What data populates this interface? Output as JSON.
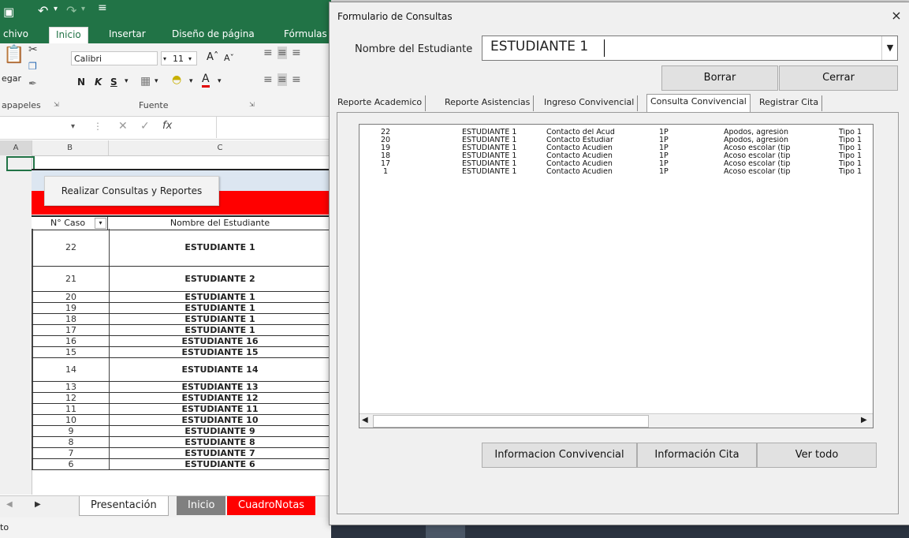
{
  "excel": {
    "tabs": [
      "chivo",
      "Inicio",
      "Insertar",
      "Diseño de página",
      "Fórmulas"
    ],
    "ribbon": {
      "paste_label": "egar",
      "font_name": "Calibri",
      "font_size": "11",
      "clipboard_group": "apapeles",
      "font_group": "Fuente",
      "bold": "N",
      "italic": "K",
      "underline": "S"
    },
    "formula_fx": "fx",
    "columns": [
      "A",
      "B",
      "C"
    ],
    "macro_button": "Realizar Consultas y Reportes",
    "table_headers": {
      "caso": "N° Caso",
      "nombre": "Nombre del Estudiante"
    },
    "rows": [
      {
        "caso": "22",
        "nombre": "ESTUDIANTE 1"
      },
      {
        "caso": "21",
        "nombre": "ESTUDIANTE 2"
      },
      {
        "caso": "20",
        "nombre": "ESTUDIANTE 1"
      },
      {
        "caso": "19",
        "nombre": "ESTUDIANTE 1"
      },
      {
        "caso": "18",
        "nombre": "ESTUDIANTE 1"
      },
      {
        "caso": "17",
        "nombre": "ESTUDIANTE 1"
      },
      {
        "caso": "16",
        "nombre": "ESTUDIANTE 16"
      },
      {
        "caso": "15",
        "nombre": "ESTUDIANTE 15"
      },
      {
        "caso": "14",
        "nombre": "ESTUDIANTE 14"
      },
      {
        "caso": "13",
        "nombre": "ESTUDIANTE 13"
      },
      {
        "caso": "12",
        "nombre": "ESTUDIANTE 12"
      },
      {
        "caso": "11",
        "nombre": "ESTUDIANTE 11"
      },
      {
        "caso": "10",
        "nombre": "ESTUDIANTE 10"
      },
      {
        "caso": "9",
        "nombre": "ESTUDIANTE 9"
      },
      {
        "caso": "8",
        "nombre": "ESTUDIANTE 8"
      },
      {
        "caso": "7",
        "nombre": "ESTUDIANTE 7"
      },
      {
        "caso": "6",
        "nombre": "ESTUDIANTE 6"
      }
    ],
    "sheet_tabs": [
      "Presentación",
      "Inicio",
      "CuadroNotas"
    ],
    "status": "to",
    "colors": {
      "excel_green": "#217346",
      "red_header": "#ff0000",
      "sheet_inicio": "#808080",
      "sheet_cuadro": "#ff0000"
    }
  },
  "dialog": {
    "title": "Formulario de Consultas",
    "close": "×",
    "student_label": "Nombre del Estudiante",
    "student_value": "ESTUDIANTE 1",
    "buttons": {
      "borrar": "Borrar",
      "cerrar": "Cerrar"
    },
    "tabs": [
      "Reporte Academico",
      "Reporte Asistencias",
      "Ingreso Convivencial",
      "Consulta Convivencial",
      "Registrar Cita"
    ],
    "active_tab": "Consulta Convivencial",
    "list": [
      [
        "22",
        "ESTUDIANTE 1",
        "Contacto del Acud",
        "1P",
        "Apodos, agresión",
        "Tipo 1"
      ],
      [
        "20",
        "ESTUDIANTE 1",
        "Contacto Estudiar",
        "1P",
        "Apodos, agresión",
        "Tipo 1"
      ],
      [
        "19",
        "ESTUDIANTE 1",
        "Contacto Acudien",
        "1P",
        "Acoso escolar (tip",
        "Tipo 1"
      ],
      [
        "18",
        "ESTUDIANTE 1",
        "Contacto Acudien",
        "1P",
        "Acoso escolar (tip",
        "Tipo 1"
      ],
      [
        "17",
        "ESTUDIANTE 1",
        "Contacto Acudien",
        "1P",
        "Acoso escolar (tip",
        "Tipo 1"
      ],
      [
        "1",
        "ESTUDIANTE 1",
        "Contacto Acudien",
        "1P",
        "Acoso escolar (tip",
        "Tipo 1"
      ]
    ],
    "bottom_buttons": {
      "info_conv": "Informacion Convivencial",
      "info_cita": "Información Cita",
      "ver_todo": "Ver todo"
    }
  }
}
